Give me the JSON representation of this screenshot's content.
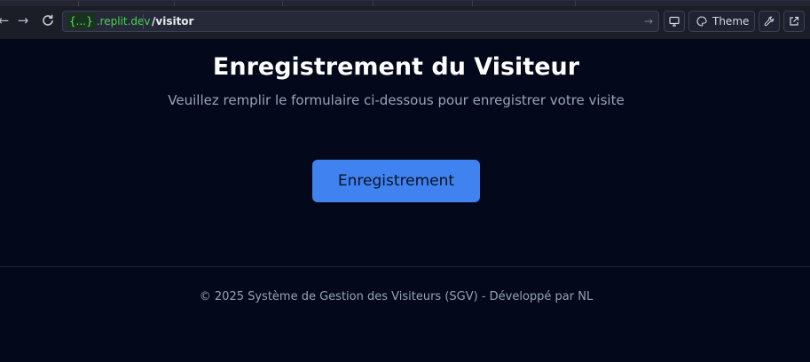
{
  "browser": {
    "url_host_tag": "{...}",
    "url_host_domain": ".replit.dev",
    "url_path": "/visitor",
    "theme_label": "Theme"
  },
  "icons": {
    "back": "arrow-left-icon",
    "forward": "arrow-right-icon",
    "reload": "reload-icon",
    "go": "arrow-right-icon",
    "devices": "monitor-icon",
    "theme": "palette-icon",
    "tools": "wrench-icon",
    "external": "external-link-icon"
  },
  "colors": {
    "background": "#03081a",
    "primary_button": "#3f82f0",
    "url_host": "#4ccf5a"
  },
  "main": {
    "title": "Enregistrement du Visiteur",
    "subtitle": "Veuillez remplir le formulaire ci-dessous pour enregistrer votre visite",
    "register_button": "Enregistrement"
  },
  "footer": {
    "text": "© 2025 Système de Gestion des Visiteurs (SGV) - Développé par NL"
  }
}
